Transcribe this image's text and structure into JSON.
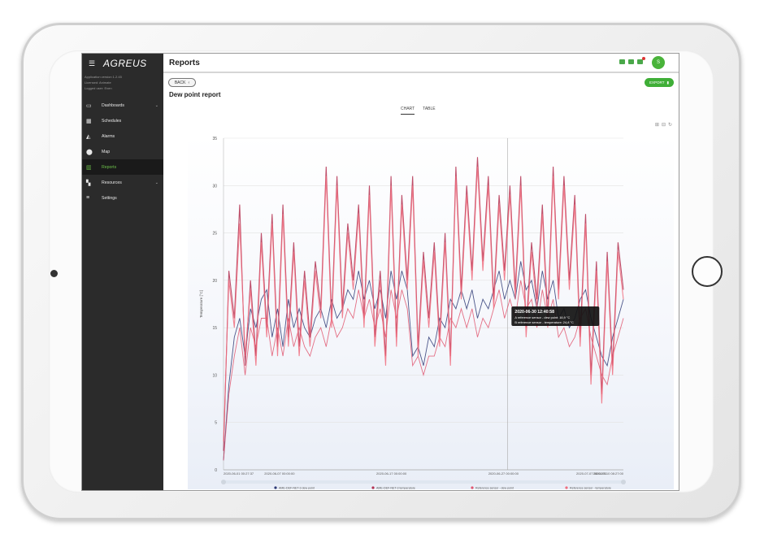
{
  "app": {
    "logo": "AGREUS",
    "menu_icon": "hamburger-icon",
    "meta_lines": [
      "Application version 1.2.45",
      "Licensed: Animate",
      "Logged user: Even"
    ]
  },
  "sidebar": {
    "items": [
      {
        "label": "Dashboards",
        "icon": "monitor-icon",
        "caret": true,
        "active": false
      },
      {
        "label": "Schedules",
        "icon": "calendar-icon",
        "caret": false,
        "active": false
      },
      {
        "label": "Alarms",
        "icon": "bell-icon",
        "caret": false,
        "active": false
      },
      {
        "label": "Map",
        "icon": "map-pin-icon",
        "caret": false,
        "active": false
      },
      {
        "label": "Reports",
        "icon": "chart-icon",
        "caret": false,
        "active": true
      },
      {
        "label": "Resources",
        "icon": "resources-icon",
        "caret": true,
        "active": false
      },
      {
        "label": "Settings",
        "icon": "settings-icon",
        "caret": false,
        "active": false
      }
    ]
  },
  "header": {
    "title": "Reports",
    "avatar_initial": "S",
    "icons": [
      "calendar-icon",
      "cloud-icon",
      "battery-icon"
    ]
  },
  "toolbar": {
    "back_label": "BACK",
    "export_label": "EXPORT"
  },
  "report": {
    "title": "Dew point report",
    "tabs": [
      {
        "label": "CHART",
        "active": true
      },
      {
        "label": "TABLE",
        "active": false
      }
    ]
  },
  "colors": {
    "accent": "#3fae37",
    "sidebar_bg": "#2b2b2b",
    "series_navy": "#2e3a76",
    "series_crimson": "#b33050",
    "series_rose": "#e0566f",
    "series_pink": "#f06d7e"
  },
  "chart_data": {
    "type": "line",
    "ylabel": "Temperature [°C]",
    "ylim": [
      0,
      35
    ],
    "y_ticks": [
      0,
      5,
      10,
      15,
      20,
      25,
      30,
      35
    ],
    "x_tick_labels": [
      "2020-06-01 00:27:37",
      "2020-06-07 00:00:00",
      "2020-06-17 00:00:00",
      "2020-06-27 00:00:00",
      "2020-07-07 00:00:00",
      "2020-07-10 08:27:00"
    ],
    "tooltip": {
      "title": "2020-06-30 12:40:58",
      "lines": [
        "A reference sensor - dew point: 16,9 °C",
        "B reference sensor - temperature: 24,8 °C"
      ]
    },
    "series": [
      {
        "name": "AME-DEF-NET-3 dew point",
        "color": "#2e3a76",
        "values": [
          1,
          9,
          14,
          16,
          12,
          17,
          15,
          18,
          19,
          14,
          17,
          13,
          18,
          15,
          17,
          15,
          14,
          16,
          17,
          15,
          18,
          16,
          17,
          19,
          18,
          21,
          18,
          20,
          17,
          19,
          16,
          21,
          18,
          21,
          19,
          12,
          13,
          11,
          14,
          13,
          16,
          15,
          18,
          17,
          19,
          17,
          19,
          16,
          18,
          17,
          19,
          21,
          18,
          20,
          18,
          22,
          19,
          20,
          17,
          21,
          18,
          20,
          16,
          17,
          15,
          16,
          18,
          19,
          16,
          14,
          12,
          11,
          14,
          16,
          18
        ]
      },
      {
        "name": "AME-DEF-NET-3 temperature",
        "color": "#b33050",
        "values": [
          2,
          21,
          16,
          28,
          11,
          20,
          12,
          25,
          15,
          27,
          13,
          28,
          14,
          24,
          13,
          21,
          14,
          22,
          17,
          32,
          16,
          31,
          17,
          26,
          20,
          28,
          16,
          30,
          14,
          21,
          12,
          31,
          14,
          29,
          20,
          31,
          13,
          23,
          16,
          24,
          14,
          25,
          12,
          32,
          19,
          30,
          21,
          33,
          22,
          31,
          18,
          29,
          21,
          30,
          19,
          31,
          15,
          24,
          18,
          28,
          16,
          32,
          19,
          31,
          20,
          29,
          14,
          27,
          10,
          22,
          8,
          23,
          11,
          24,
          19
        ]
      },
      {
        "name": "Reference sensor - dew point",
        "color": "#e0566f",
        "values": [
          1,
          8,
          12,
          15,
          10,
          15,
          13,
          16,
          16,
          12,
          15,
          12,
          16,
          13,
          15,
          13,
          12,
          14,
          15,
          13,
          16,
          14,
          15,
          17,
          16,
          19,
          16,
          18,
          15,
          17,
          14,
          19,
          16,
          19,
          17,
          11,
          12,
          10,
          12,
          12,
          14,
          13,
          16,
          15,
          17,
          15,
          17,
          14,
          16,
          15,
          17,
          19,
          16,
          18,
          16,
          20,
          17,
          18,
          15,
          19,
          16,
          18,
          14,
          15,
          13,
          14,
          16,
          17,
          14,
          12,
          10,
          9,
          12,
          14,
          16
        ]
      },
      {
        "name": "Reference sensor - temperature",
        "color": "#f06d7e",
        "values": [
          3,
          20,
          15,
          26,
          12,
          19,
          11,
          24,
          14,
          26,
          12,
          27,
          13,
          23,
          12,
          20,
          13,
          21,
          16,
          31,
          15,
          30,
          16,
          25,
          19,
          27,
          15,
          29,
          13,
          20,
          11,
          30,
          13,
          28,
          19,
          30,
          12,
          22,
          15,
          23,
          13,
          24,
          11,
          31,
          18,
          29,
          20,
          32,
          21,
          30,
          17,
          28,
          20,
          29,
          18,
          30,
          14,
          23,
          17,
          27,
          15,
          31,
          18,
          30,
          19,
          28,
          13,
          26,
          9,
          21,
          7,
          22,
          10,
          23,
          18
        ]
      }
    ]
  }
}
